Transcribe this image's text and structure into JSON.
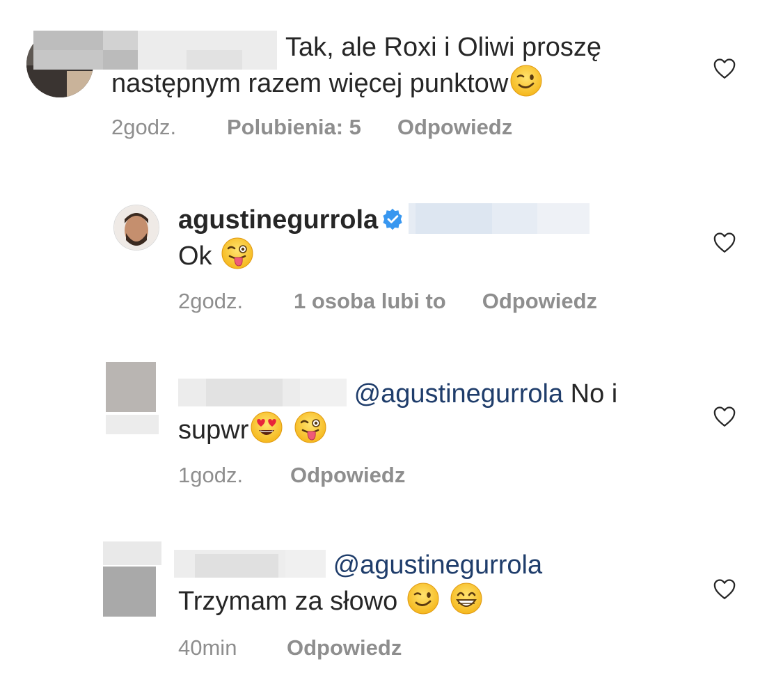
{
  "comments": [
    {
      "username": "",
      "text": "Tak, ale Roxi i Oliwi proszę następnym razem więcej punktow",
      "line1": "Tak, ale Roxi i Oliwi proszę",
      "line2": "następnym razem więcej punktow",
      "emojis": [
        "wink-emoji"
      ],
      "time": "2godz.",
      "likes": "Polubienia: 5",
      "reply": "Odpowiedz"
    },
    {
      "username": "agustinegurrola",
      "verified": true,
      "text": "Ok",
      "emojis": [
        "tongue-wink-emoji"
      ],
      "time": "2godz.",
      "likes": "1 osoba lubi to",
      "reply": "Odpowiedz"
    },
    {
      "username": "",
      "mention": "@agustinegurrola",
      "text_after_mention": "No i",
      "line2": "supwr",
      "emojis": [
        "heart-eyes-emoji",
        "tongue-wink-emoji"
      ],
      "time": "1godz.",
      "reply": "Odpowiedz"
    },
    {
      "username": "",
      "mention": "@agustinegurrola",
      "line2": "Trzymam za słowo",
      "emojis": [
        "wink-emoji",
        "grin-emoji"
      ],
      "time": "40min",
      "reply": "Odpowiedz"
    }
  ],
  "colors": {
    "text": "#262626",
    "meta": "#8e8e8e",
    "mention": "#1f3d6b",
    "verified": "#3897f0",
    "heart": "#262626"
  }
}
